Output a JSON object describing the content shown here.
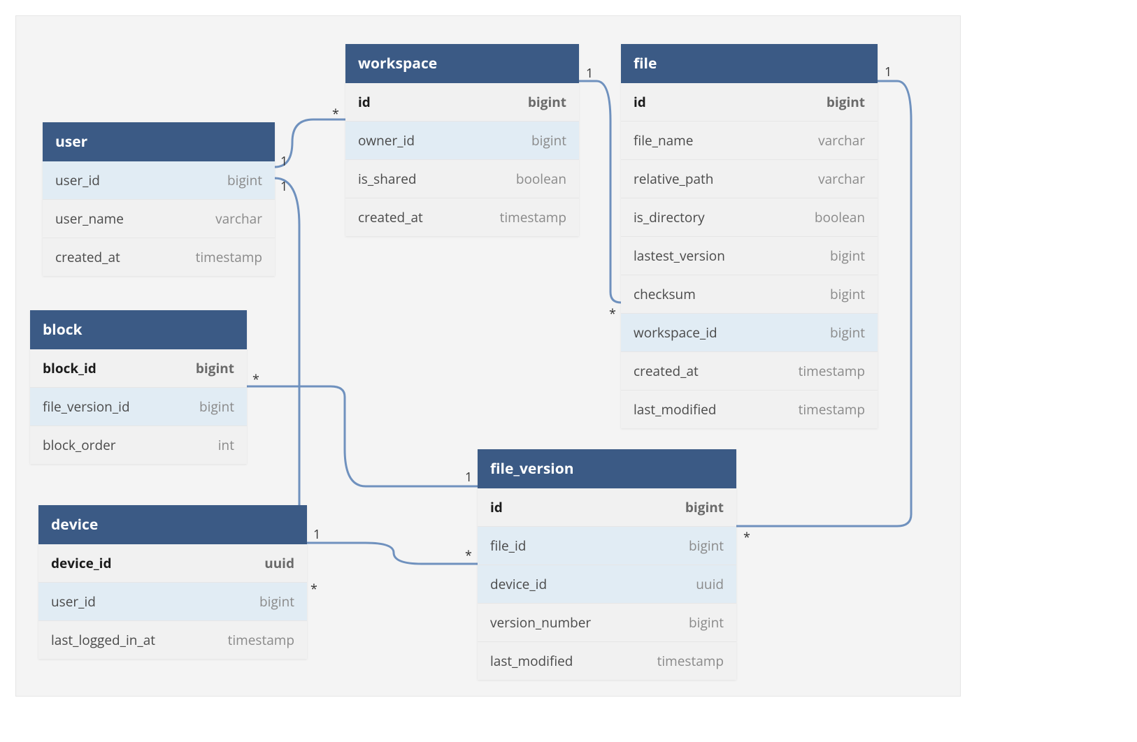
{
  "entities": {
    "user": {
      "title": "user",
      "columns": [
        {
          "name": "user_id",
          "type": "bigint",
          "pk": false,
          "fk": true
        },
        {
          "name": "user_name",
          "type": "varchar",
          "pk": false,
          "fk": false
        },
        {
          "name": "created_at",
          "type": "timestamp",
          "pk": false,
          "fk": false
        }
      ]
    },
    "workspace": {
      "title": "workspace",
      "columns": [
        {
          "name": "id",
          "type": "bigint",
          "pk": true,
          "fk": false
        },
        {
          "name": "owner_id",
          "type": "bigint",
          "pk": false,
          "fk": true
        },
        {
          "name": "is_shared",
          "type": "boolean",
          "pk": false,
          "fk": false
        },
        {
          "name": "created_at",
          "type": "timestamp",
          "pk": false,
          "fk": false
        }
      ]
    },
    "file": {
      "title": "file",
      "columns": [
        {
          "name": "id",
          "type": "bigint",
          "pk": true,
          "fk": false
        },
        {
          "name": "file_name",
          "type": "varchar",
          "pk": false,
          "fk": false
        },
        {
          "name": "relative_path",
          "type": "varchar",
          "pk": false,
          "fk": false
        },
        {
          "name": "is_directory",
          "type": "boolean",
          "pk": false,
          "fk": false
        },
        {
          "name": "lastest_version",
          "type": "bigint",
          "pk": false,
          "fk": false
        },
        {
          "name": "checksum",
          "type": "bigint",
          "pk": false,
          "fk": false
        },
        {
          "name": "workspace_id",
          "type": "bigint",
          "pk": false,
          "fk": true
        },
        {
          "name": "created_at",
          "type": "timestamp",
          "pk": false,
          "fk": false
        },
        {
          "name": "last_modified",
          "type": "timestamp",
          "pk": false,
          "fk": false
        }
      ]
    },
    "block": {
      "title": "block",
      "columns": [
        {
          "name": "block_id",
          "type": "bigint",
          "pk": true,
          "fk": false
        },
        {
          "name": "file_version_id",
          "type": "bigint",
          "pk": false,
          "fk": true
        },
        {
          "name": "block_order",
          "type": "int",
          "pk": false,
          "fk": false
        }
      ]
    },
    "file_version": {
      "title": "file_version",
      "columns": [
        {
          "name": "id",
          "type": "bigint",
          "pk": true,
          "fk": false
        },
        {
          "name": "file_id",
          "type": "bigint",
          "pk": false,
          "fk": true
        },
        {
          "name": "device_id",
          "type": "uuid",
          "pk": false,
          "fk": true
        },
        {
          "name": "version_number",
          "type": "bigint",
          "pk": false,
          "fk": false
        },
        {
          "name": "last_modified",
          "type": "timestamp",
          "pk": false,
          "fk": false
        }
      ]
    },
    "device": {
      "title": "device",
      "columns": [
        {
          "name": "device_id",
          "type": "uuid",
          "pk": true,
          "fk": false
        },
        {
          "name": "user_id",
          "type": "bigint",
          "pk": false,
          "fk": true
        },
        {
          "name": "last_logged_in_at",
          "type": "timestamp",
          "pk": false,
          "fk": false
        }
      ]
    }
  },
  "relationships": [
    {
      "from": "user.user_id",
      "to": "workspace.owner_id",
      "from_card": "1",
      "to_card": "*"
    },
    {
      "from": "user.user_id",
      "to": "device.user_id",
      "from_card": "1",
      "to_card": "*"
    },
    {
      "from": "workspace.id",
      "to": "file.workspace_id",
      "from_card": "1",
      "to_card": "*"
    },
    {
      "from": "file.id",
      "to": "file_version.file_id",
      "from_card": "1",
      "to_card": "*"
    },
    {
      "from": "device.device_id",
      "to": "file_version.device_id",
      "from_card": "1",
      "to_card": "*"
    },
    {
      "from": "file_version.id",
      "to": "block.file_version_id",
      "from_card": "1",
      "to_card": "*"
    }
  ],
  "cardinality_labels": {
    "user_workspace_1": "1",
    "user_workspace_star": "*",
    "user_device_1": "1",
    "user_device_star": "*",
    "workspace_file_1": "1",
    "workspace_file_star": "*",
    "file_fileversion_1": "1",
    "file_fileversion_star": "*",
    "device_fileversion_1": "1",
    "device_fileversion_star": "*",
    "fileversion_block_1": "1",
    "fileversion_block_star": "*"
  }
}
